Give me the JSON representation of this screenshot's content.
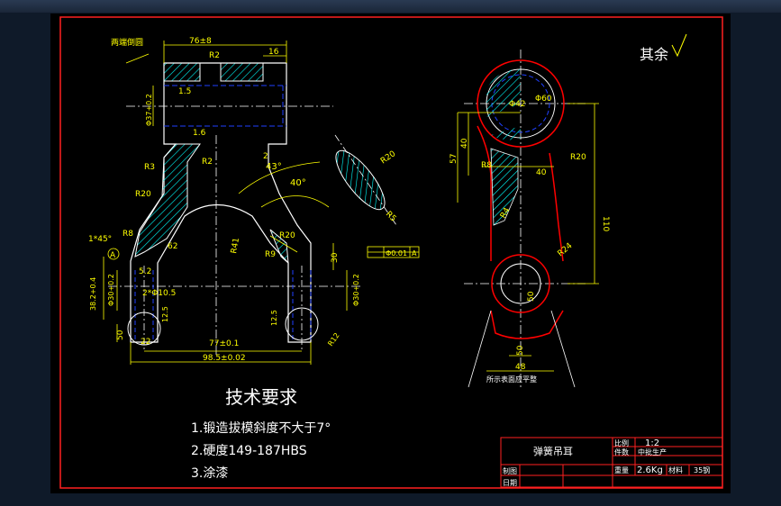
{
  "colors": {
    "background": "#000000",
    "frame": "#ff2020",
    "outline": "#ffffff",
    "dimension": "#ffff00",
    "center": "#ffffff",
    "hidden": "#2040ff",
    "hatch": "#00ffff",
    "part": "#ff0000"
  },
  "left_view": {
    "top_note": "两端倒圆",
    "dims": {
      "width_top": "76±8",
      "r2_top": "R2",
      "w16": "16",
      "d15": "1.5",
      "d16": "1.6",
      "dia37": "Φ37+0.2",
      "r3": "R3",
      "r2_mid": "R2",
      "r20": "R20",
      "r8": "R8",
      "chamfer": "1*45°",
      "a_label": "A",
      "d62": "62",
      "d52": "5.2",
      "d382": "38.2+0.4",
      "dia30": "Φ30+0.2",
      "holes": "2*Φ10.5",
      "d125a": "12.5",
      "d50": "50",
      "d22": "22",
      "d77": "77±0.1",
      "d985": "98.5±0.02",
      "d125b": "12.5",
      "r12": "R12",
      "d30": "30",
      "dia30b": "Φ30+0.2",
      "tol": "Φ0.01",
      "tol_ref": "A",
      "a43": "43°",
      "a40": "40°",
      "r41": "R41",
      "r20b": "R20",
      "r9": "R9",
      "r20c": "R20",
      "r5": "R5",
      "d2": "2"
    }
  },
  "right_view": {
    "d42": "Φ42",
    "d60": "Φ60",
    "d57": "57",
    "d40": "40",
    "r8": "R8",
    "d40h": "40",
    "r20": "R20",
    "r4": "R4",
    "d110": "110",
    "r24": "R24",
    "d50": "50",
    "d50b": "50",
    "d48": "48",
    "caption": "所示表面应平整"
  },
  "rest_note": "其余",
  "tech": {
    "title": "技术要求",
    "items": [
      "1.锻造拔模斜度不大于7°",
      "2.硬度149-187HBS",
      "3.涂漆"
    ]
  },
  "title_block": {
    "name": "弹簧吊耳",
    "scale_label": "比例",
    "scale": "1:2",
    "qty_label": "件数",
    "qty": "中批生产",
    "weight_label": "重量",
    "weight": "2.6Kg",
    "material_label": "材料",
    "material": "35钢",
    "drawn_label": "制图",
    "date_label": "日期"
  }
}
